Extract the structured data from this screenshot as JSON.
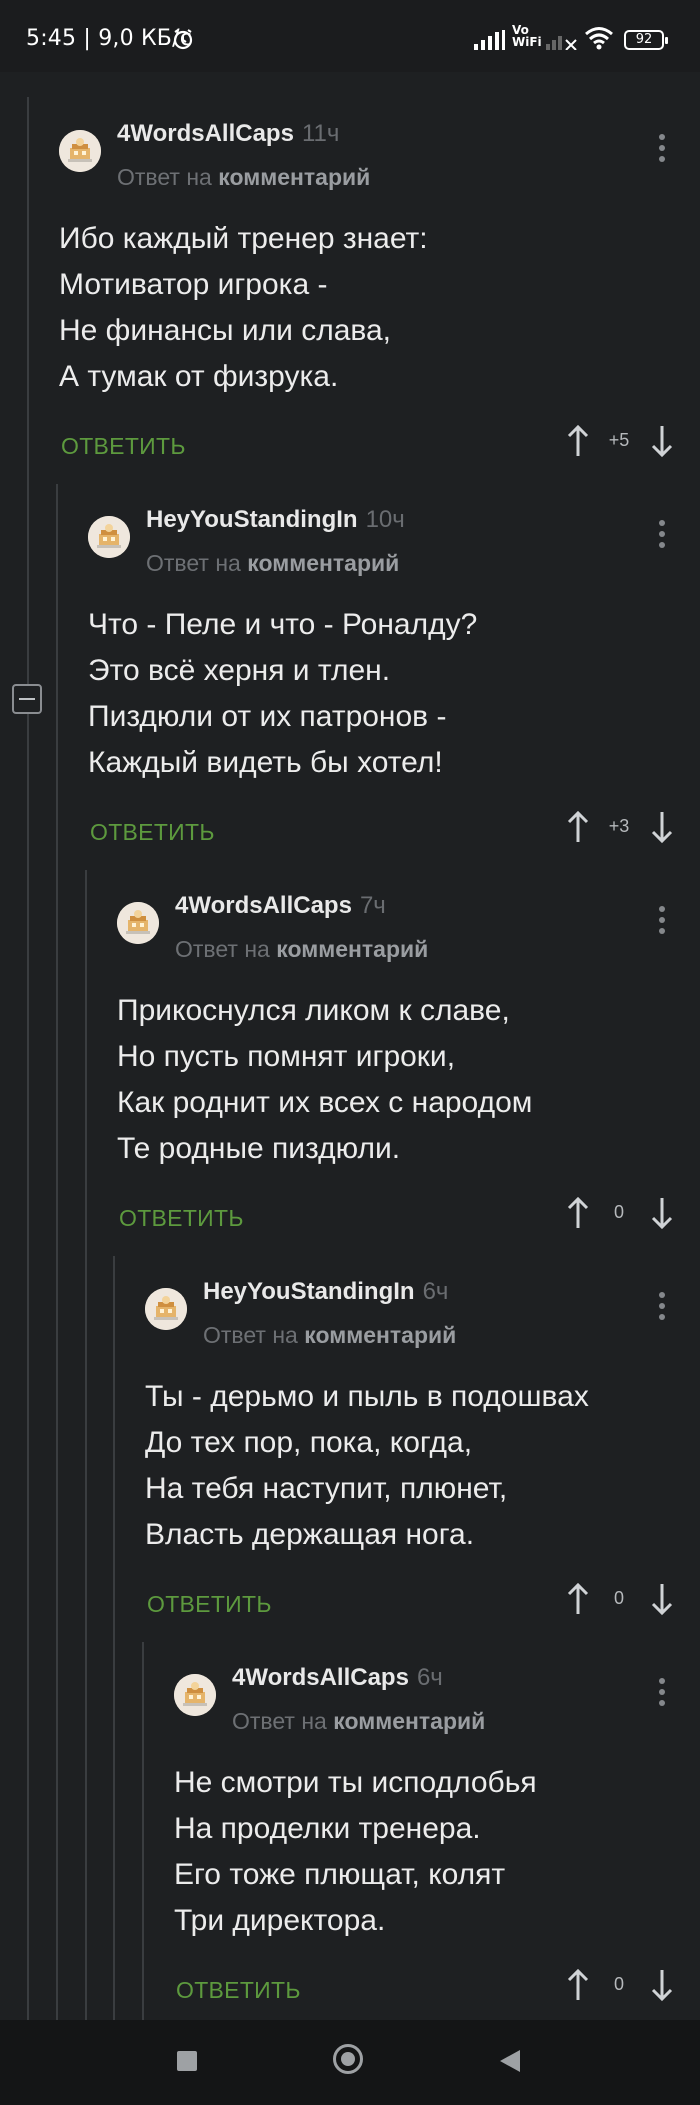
{
  "status_bar": {
    "time": "5:45 | 9,0 КБ/с",
    "vowifi_top": "Vo",
    "vowifi_bottom": "WiFi",
    "battery": "92"
  },
  "reply_label": "ОТВЕТИТЬ",
  "comments": [
    {
      "author": "4WordsAllCaps",
      "ago": "11ч",
      "reply_prefix": "Ответ на",
      "reply_target": "комментарий",
      "lines": [
        "Ибо каждый тренер знает:",
        "Мотиватор игрока -",
        "Не финансы или слава,",
        "А тумак от физрука."
      ],
      "score": "+5"
    },
    {
      "author": "HeyYouStandingIn",
      "ago": "10ч",
      "reply_prefix": "Ответ на",
      "reply_target": "комментарий",
      "lines": [
        "Что - Пеле и что - Роналду?",
        "Это всё херня и тлен.",
        "Пиздюли от их патронов -",
        "Каждый видеть бы хотел!"
      ],
      "score": "+3"
    },
    {
      "author": "4WordsAllCaps",
      "ago": "7ч",
      "reply_prefix": "Ответ на",
      "reply_target": "комментарий",
      "lines": [
        "Прикоснулся ликом к славе,",
        "Но пусть помнят игроки,",
        "Как роднит их всех с народом",
        "Те родные пиздюли."
      ],
      "score": "0"
    },
    {
      "author": "HeyYouStandingIn",
      "ago": "6ч",
      "reply_prefix": "Ответ на",
      "reply_target": "комментарий",
      "lines": [
        "Ты - дерьмо и пыль в подошвах",
        "До тех пор, пока, когда,",
        "На тебя наступит, плюнет,",
        "Власть держащая нога."
      ],
      "score": "0"
    },
    {
      "author": "4WordsAllCaps",
      "ago": "6ч",
      "reply_prefix": "Ответ на",
      "reply_target": "комментарий",
      "lines": [
        "Не смотри ты исподлобья",
        "На проделки тренера.",
        "Его тоже плющат, колят",
        "Три директора."
      ],
      "score": "0"
    }
  ]
}
